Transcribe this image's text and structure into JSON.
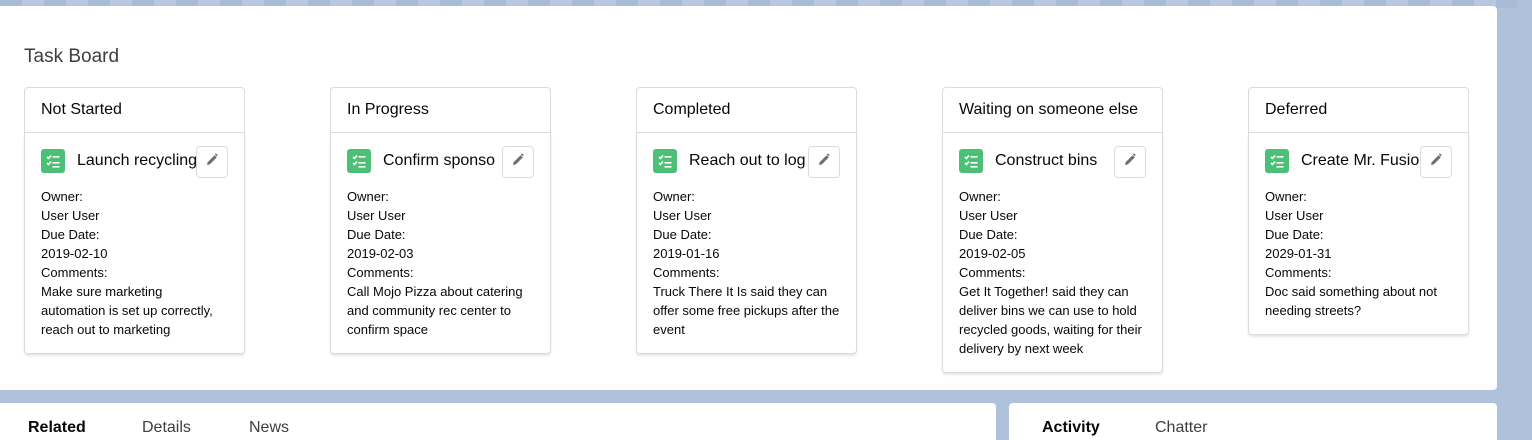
{
  "board": {
    "title": "Task Board",
    "columns": [
      {
        "header": "Not Started",
        "card": {
          "title": "Launch recycling",
          "owner_label": "Owner:",
          "owner": "User User",
          "due_label": "Due Date:",
          "due": "2019-02-10",
          "comments_label": "Comments:",
          "comments": "Make sure marketing automation is set up correctly, reach out to marketing"
        }
      },
      {
        "header": "In Progress",
        "card": {
          "title": "Confirm sponso",
          "owner_label": "Owner:",
          "owner": "User User",
          "due_label": "Due Date:",
          "due": "2019-02-03",
          "comments_label": "Comments:",
          "comments": "Call Mojo Pizza about catering and community rec center to confirm space"
        }
      },
      {
        "header": "Completed",
        "card": {
          "title": "Reach out to log",
          "owner_label": "Owner:",
          "owner": "User User",
          "due_label": "Due Date:",
          "due": "2019-01-16",
          "comments_label": "Comments:",
          "comments": "Truck There It Is said they can offer some free pickups after the event"
        }
      },
      {
        "header": "Waiting on someone else",
        "card": {
          "title": "Construct bins",
          "owner_label": "Owner:",
          "owner": "User User",
          "due_label": "Due Date:",
          "due": "2019-02-05",
          "comments_label": "Comments:",
          "comments": "Get It Together! said they can deliver bins we can use to hold recycled goods, waiting for their delivery by next week"
        }
      },
      {
        "header": "Deferred",
        "card": {
          "title": "Create Mr. Fusio",
          "owner_label": "Owner:",
          "owner": "User User",
          "due_label": "Due Date:",
          "due": "2029-01-31",
          "comments_label": "Comments:",
          "comments": "Doc said something about not needing streets?"
        }
      }
    ]
  },
  "left_tabs": [
    "Related",
    "Details",
    "News"
  ],
  "right_tabs": [
    "Activity",
    "Chatter"
  ],
  "colors": {
    "task_icon": "#4bc076",
    "background": "#b0c1dc"
  }
}
